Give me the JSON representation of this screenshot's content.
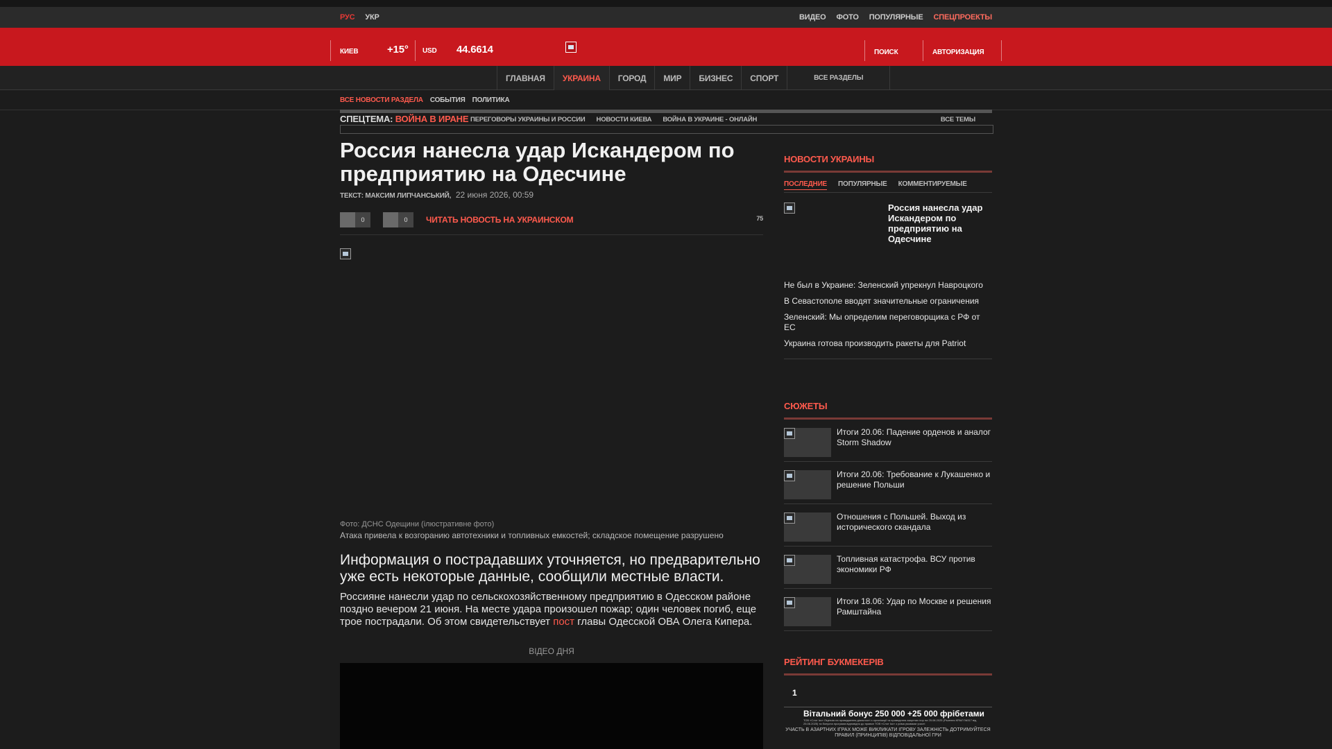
{
  "topbar": {
    "lang_active": "РУС",
    "lang_other": "УКР",
    "links": [
      "ВИДЕО",
      "ФОТО",
      "ПОПУЛЯРНЫЕ"
    ],
    "special_link": "СПЕЦПРОЕКТЫ"
  },
  "header": {
    "city": "КИЕВ",
    "temperature": "+15°",
    "currency": "USD",
    "rate": "44.6614",
    "search": "ПОИСК",
    "auth": "АВТОРИЗАЦИЯ"
  },
  "nav": {
    "items": [
      "ГЛАВНАЯ",
      "УКРАИНА",
      "ГОРОД",
      "МИР",
      "БИЗНЕС",
      "СПОРТ"
    ],
    "active": "УКРАИНА",
    "all_sections": "ВСЕ РАЗДЕЛЫ"
  },
  "subnav": {
    "items": [
      "ВСЕ НОВОСТИ РАЗДЕЛА",
      "СОБЫТИЯ",
      "ПОЛИТИКА"
    ]
  },
  "special_theme": {
    "label": "СПЕЦТЕМА:",
    "highlight": "ВОЙНА В ИРАНЕ",
    "links": [
      "ПЕРЕГОВОРЫ УКРАИНЫ И РОССИИ",
      "НОВОСТИ КИЕВА",
      "ВОЙНА В УКРАИНЕ - ОНЛАЙН"
    ],
    "all": "ВСЕ ТЕМЫ"
  },
  "article": {
    "title": "Россия нанесла удар Искандером по предприятию на Одесчине",
    "author": "ТЕКСТ: МАКСИМ ЛИПЧАНСЬКИЙ,",
    "date": "22 июня 2026, 00:59",
    "share_counts": [
      "0",
      "0"
    ],
    "read_ukr": "ЧИТАТЬ НОВОСТЬ НА УКРАИНСКОМ",
    "comments": "75",
    "photo_credit": "Фото: ДСНС Одещини (ілюстративне фото)",
    "photo_caption": "Атака привела к возгоранию автотехники и топливных емкостей; складское помещение разрушено",
    "lead": "Информация о пострадавших уточняется, но предварительно уже есть некоторые данные, сообщили местные власти.",
    "body_before": "Россияне нанесли удар по сельскохозяйственному предприятию в Одесском районе поздно вечером 21 июня. На месте удара произошел пожар; один человек погиб, еще трое пострадали. Об этом свидетельствует ",
    "body_link": "пост",
    "body_after": " главы Одесской ОВА Олега Кипера.",
    "video_label": "ВІДЕО ДНЯ"
  },
  "sidebar": {
    "title": "НОВОСТИ УКРАИНЫ",
    "tabs": [
      "ПОСЛЕДНИЕ",
      "ПОПУЛЯРНЫЕ",
      "КОММЕНТИРУЕМЫЕ"
    ],
    "featured": "Россия нанесла удар Искандером по предприятию на Одесчине",
    "news": [
      "Не был в Украине: Зеленский упрекнул Навроцкого",
      "В Севастополе вводят значительные ограничения",
      "Зеленский: Мы определим переговорщика с РФ от ЕС",
      "Украина готова производить ракеты для Patriot"
    ]
  },
  "stories": {
    "title": "СЮЖЕТЫ",
    "items": [
      "Итоги 20.06: Падение орденов и аналог Storm Shadow",
      "Итоги 20.06: Требование к Лукашенко и решение Польши",
      "Отношения с Польшей. Выход из исторического скандала",
      "Топливная катастрофа. ВСУ против экономики РФ",
      "Итоги 18.06: Удар по Москве и решения Рамштайна"
    ]
  },
  "rating": {
    "title": "РЕЙТИНГ БУКМЕКЕРІВ",
    "number": "1",
    "bonus": "Вітальний бонус 250 000 +25 000 фрібетами",
    "fine_print": "ТОВ «Слот Ікс» Ліцензія на провадження діяльності з організації та проведення азартних ігор на 25.08.2025 (Рішення КРАІЛ №317 від 25.06.2025) та бонусна програма відповідно до правил ТОВ «Слот Ікс» з усіма умовами участі",
    "warning": "УЧАСТЬ В АЗАРТНИХ ІГРАХ МОЖЕ ВИКЛИКАТИ ІГРОВУ ЗАЛЕЖНІСТЬ ДОТРИМУЙТЕСЯ ПРАВИЛ (ПРИНЦИПІВ) ВІДПОВІДАЛЬНОЇ ГРИ"
  },
  "colors": {
    "brand_red": "#c8181e",
    "accent": "#ff5a4d",
    "background": "#1c1c1c"
  }
}
